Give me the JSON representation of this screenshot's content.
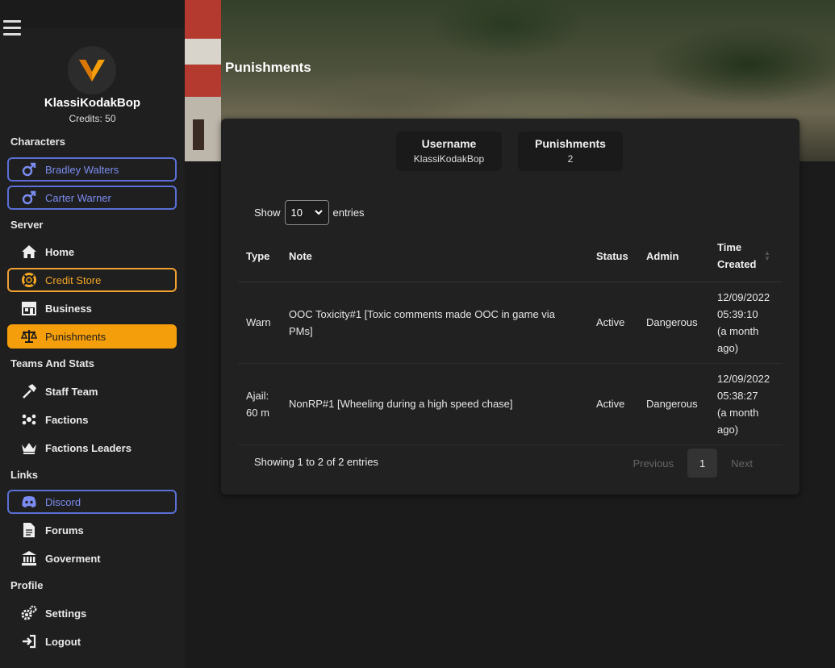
{
  "header": {
    "title": "Punishments"
  },
  "sidebar": {
    "profile": {
      "name": "KlassiKodakBop",
      "credits": "Credits: 50"
    },
    "sections": {
      "characters": "Characters",
      "server": "Server",
      "teams": "Teams And Stats",
      "links": "Links",
      "profile": "Profile"
    },
    "characters": [
      {
        "label": "Bradley Walters",
        "icon": "male-icon"
      },
      {
        "label": "Carter Warner",
        "icon": "male-icon"
      }
    ],
    "server": {
      "home": "Home",
      "credit_store": "Credit Store",
      "business": "Business",
      "punishments": "Punishments"
    },
    "teams": {
      "staff": "Staff Team",
      "factions": "Factions",
      "leaders": "Factions Leaders"
    },
    "links": {
      "discord": "Discord",
      "forums": "Forums",
      "government": "Goverment"
    },
    "profile_links": {
      "settings": "Settings",
      "logout": "Logout"
    }
  },
  "stats": [
    {
      "label": "Username",
      "value": "KlassiKodakBop"
    },
    {
      "label": "Punishments",
      "value": "2"
    }
  ],
  "table": {
    "show_label": "Show",
    "entries_label": "entries",
    "page_size": "10",
    "columns": {
      "type": "Type",
      "note": "Note",
      "status": "Status",
      "admin": "Admin",
      "time_line1": "Time",
      "time_line2": "Created"
    },
    "rows": [
      {
        "type": "Warn",
        "note": "OOC Toxicity#1 [Toxic comments made OOC in game via PMs]",
        "status": "Active",
        "admin": "Dangerous",
        "date": "12/09/2022",
        "time": "05:39:10",
        "ago": "(a month ago)"
      },
      {
        "type": "Ajail: 60 m",
        "note": "NonRP#1 [Wheeling during a high speed chase]",
        "status": "Active",
        "admin": "Dangerous",
        "date": "12/09/2022",
        "time": "05:38:27",
        "ago": "(a month ago)"
      }
    ],
    "info": "Showing 1 to 2 of 2 entries",
    "pagination": {
      "previous": "Previous",
      "current": "1",
      "next": "Next"
    }
  },
  "colors": {
    "accent": "#f59e0b",
    "discord_blue": "#5b6fd6",
    "sidebar_bg": "#1f1f1f",
    "card_bg": "#212121"
  }
}
